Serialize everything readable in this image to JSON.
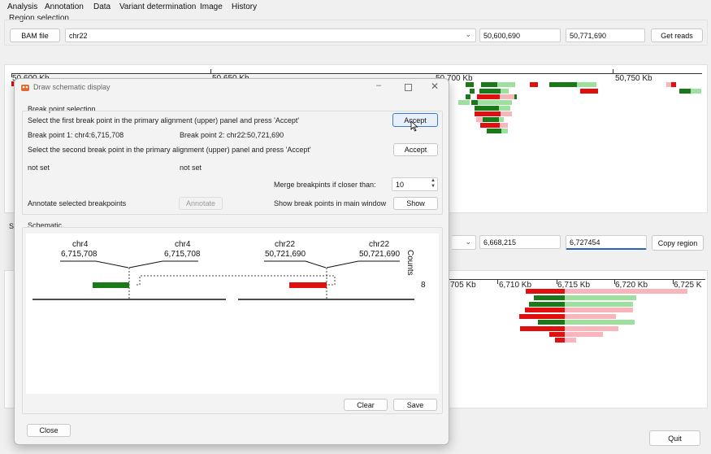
{
  "menu": [
    "Analysis",
    "Annotation",
    "Data",
    "Variant determination",
    "Image",
    "History"
  ],
  "region": {
    "group_label": "Region selection",
    "bam_button": "BAM file",
    "chrom": "chr22",
    "start": "50,600,690",
    "end": "50,771,690",
    "get_reads": "Get reads"
  },
  "upper_axis": {
    "ticks": [
      "50,600 Kb",
      "50,650 Kb",
      "50,700 Kb",
      "50,750 Kb"
    ]
  },
  "second_region": {
    "group_label_partial": "Se",
    "start": "6,668,215",
    "end": "6,727454",
    "copy_region": "Copy region"
  },
  "lower_axis": {
    "ticks": [
      "705 Kb",
      "6,710 Kb",
      "6,715 Kb",
      "6,720 Kb",
      "6,725 K"
    ]
  },
  "quit_button": "Quit",
  "dialog": {
    "title": "Draw schematic display",
    "breakpoint_group": "Break point selection",
    "instr1": "Select the first break point in the primary alignment (upper) panel and press 'Accept'",
    "accept1": "Accept",
    "bp1": "Break point 1: chr4:6,715,708",
    "bp2": "Break point 2: chr22:50,721,690",
    "instr2": "Select the second break point in the primary alignment (upper) panel and press 'Accept'",
    "accept2": "Accept",
    "not_set_1": "not set",
    "not_set_2": "not set",
    "merge_label": "Merge breakpints if closer than:",
    "merge_value": "10",
    "annotate_label": "Annotate selected breakpoints",
    "annotate_button": "Annotate",
    "show_label": "Show break points in main window",
    "show_button": "Show",
    "schematic_group": "Schematic",
    "clear_button": "Clear",
    "save_button": "Save",
    "close_button": "Close",
    "schematic": {
      "labels": [
        {
          "chrom": "chr4",
          "pos": "6,715,708"
        },
        {
          "chrom": "chr4",
          "pos": "6,715,708"
        },
        {
          "chrom": "chr22",
          "pos": "50,721,690"
        },
        {
          "chrom": "chr22",
          "pos": "50,721,690"
        }
      ],
      "counts_label": "Counts",
      "count": "8",
      "colors": {
        "left_block": "#1a7a1a",
        "right_block": "#e01010"
      }
    }
  }
}
